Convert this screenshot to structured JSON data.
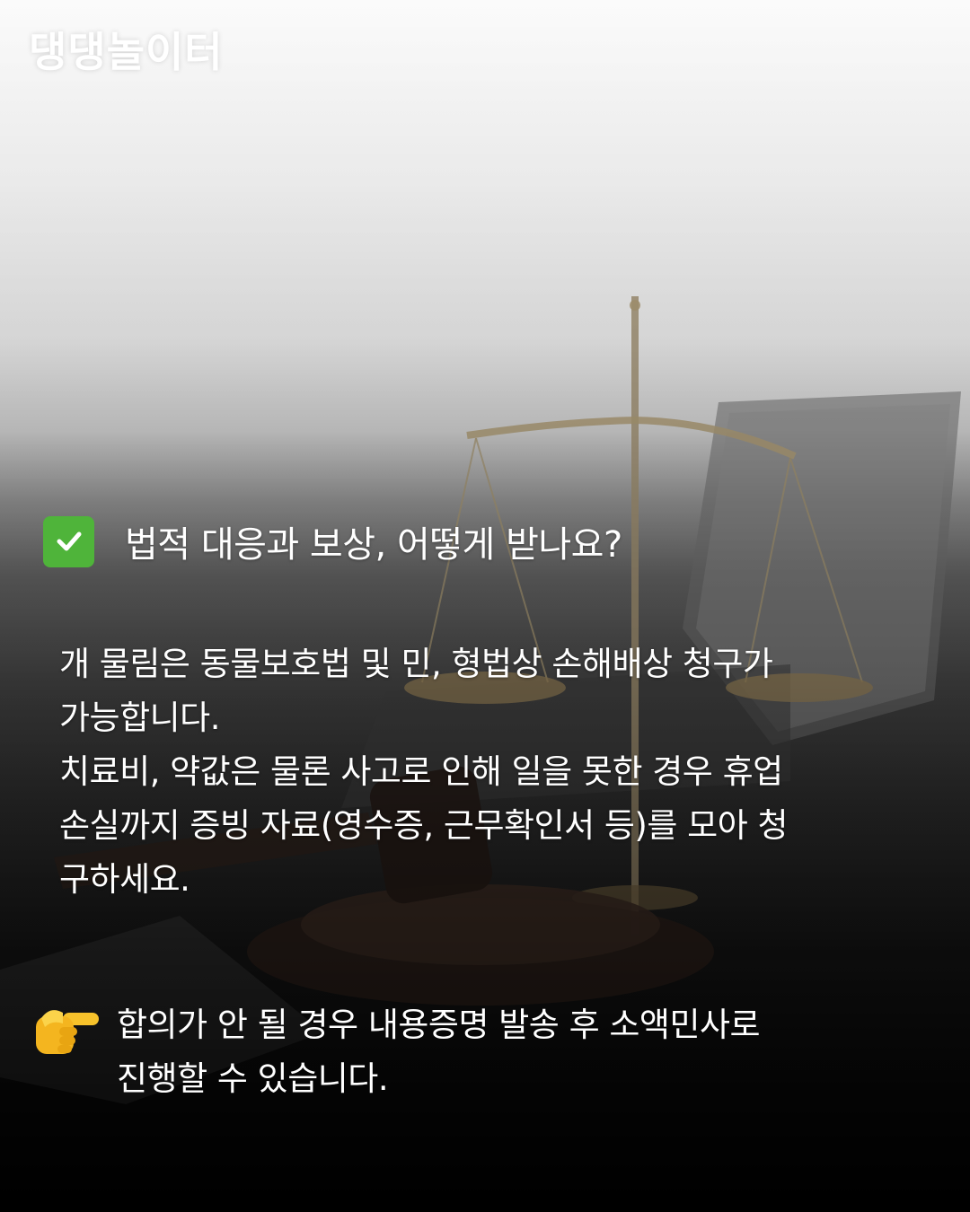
{
  "brand": {
    "name": "댕댕놀이터"
  },
  "heading": {
    "icon": "check-mark-button-icon",
    "text": "법적 대응과 보상, 어떻게 받나요?"
  },
  "body": {
    "lines": [
      "개 물림은 동물보호법 및 민, 형법상 손해배상 청구가",
      "가능합니다.",
      "치료비, 약값은 물론 사고로 인해 일을 못한 경우 휴업",
      "손실까지 증빙 자료(영수증, 근무확인서 등)를 모아 청",
      "구하세요."
    ]
  },
  "tip": {
    "icon": "backhand-index-pointing-right-icon",
    "lines": [
      "합의가 안 될 경우 내용증명 발송 후 소액민사로",
      "진행할 수 있습니다."
    ]
  },
  "colors": {
    "check_green": "#4fb43a",
    "text": "#ffffff",
    "hand_yellow": "#f7c22b"
  }
}
